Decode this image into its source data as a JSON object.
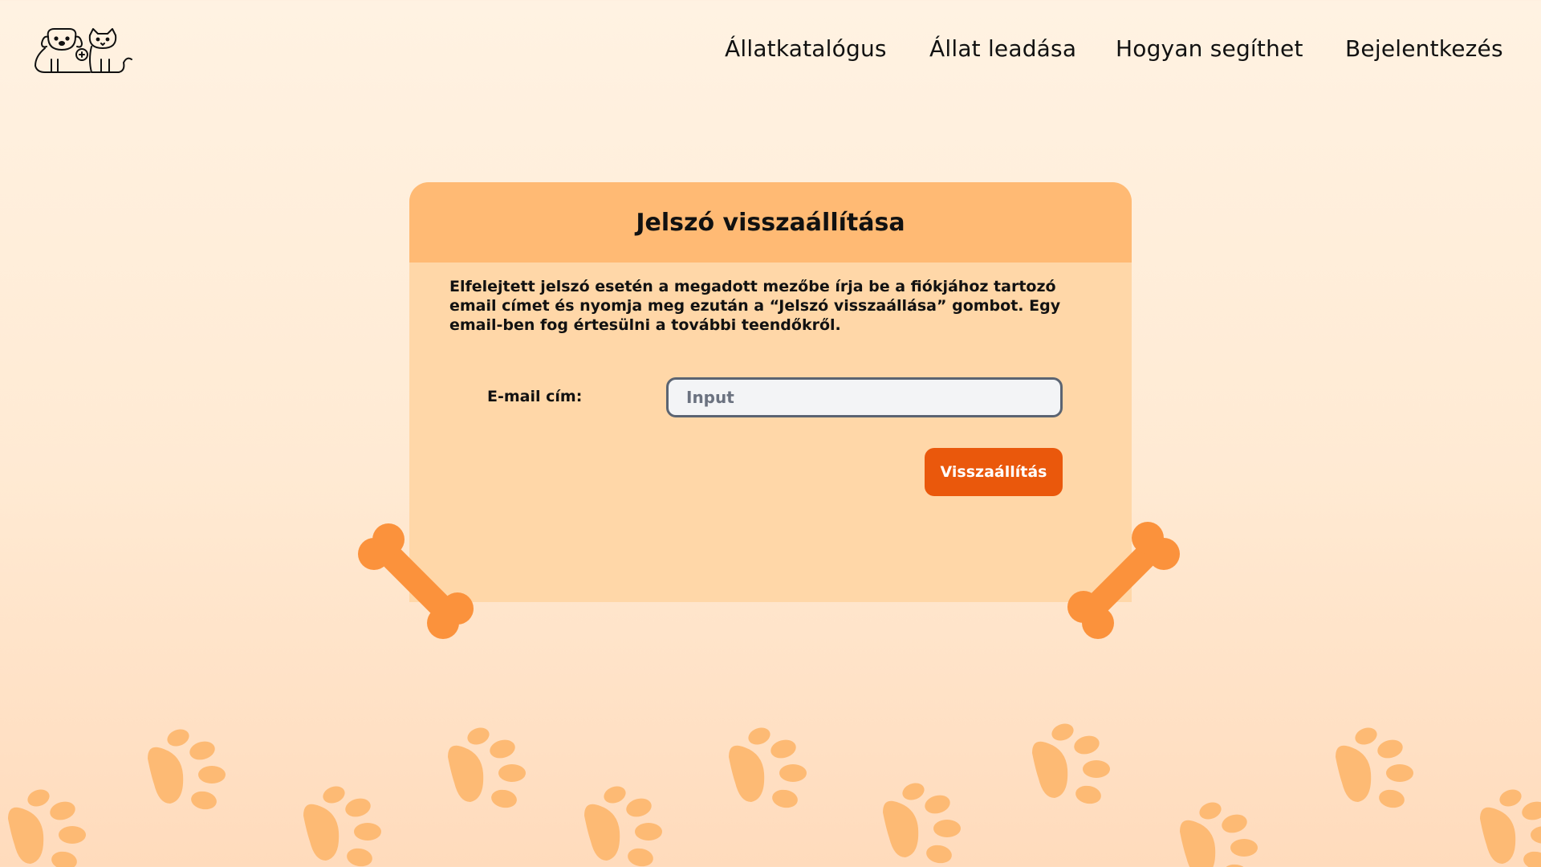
{
  "logo": {
    "name": "dog-and-cat-logo"
  },
  "nav": {
    "items": [
      {
        "label": "Állatkatalógus"
      },
      {
        "label": "Állat leadása"
      },
      {
        "label": "Hogyan segíthet"
      },
      {
        "label": "Bejelentkezés"
      }
    ]
  },
  "card": {
    "title": "Jelszó visszaállítása",
    "description": "Elfelejtett jelszó esetén a megadott mezőbe írja be a  fiókjához tartozó email címet és nyomja meg ezután a “Jelszó visszaállása” gombot. Egy email-ben fog értesülni a további teendőkről.",
    "email_label": "E-mail cím:",
    "email_placeholder": "Input",
    "email_value": "",
    "reset_button": "Visszaállítás"
  },
  "colors": {
    "background_top": "#fff2e2",
    "background_bottom": "#ffdbbc",
    "card_header": "#ffba74",
    "card_body": "#ffd7a8",
    "button": "#ea580c",
    "bone": "#fb923c",
    "paw": "#fdba74"
  },
  "decorations": {
    "bone_icon": "bone-icon",
    "paw_icon": "paw-print-icon"
  }
}
